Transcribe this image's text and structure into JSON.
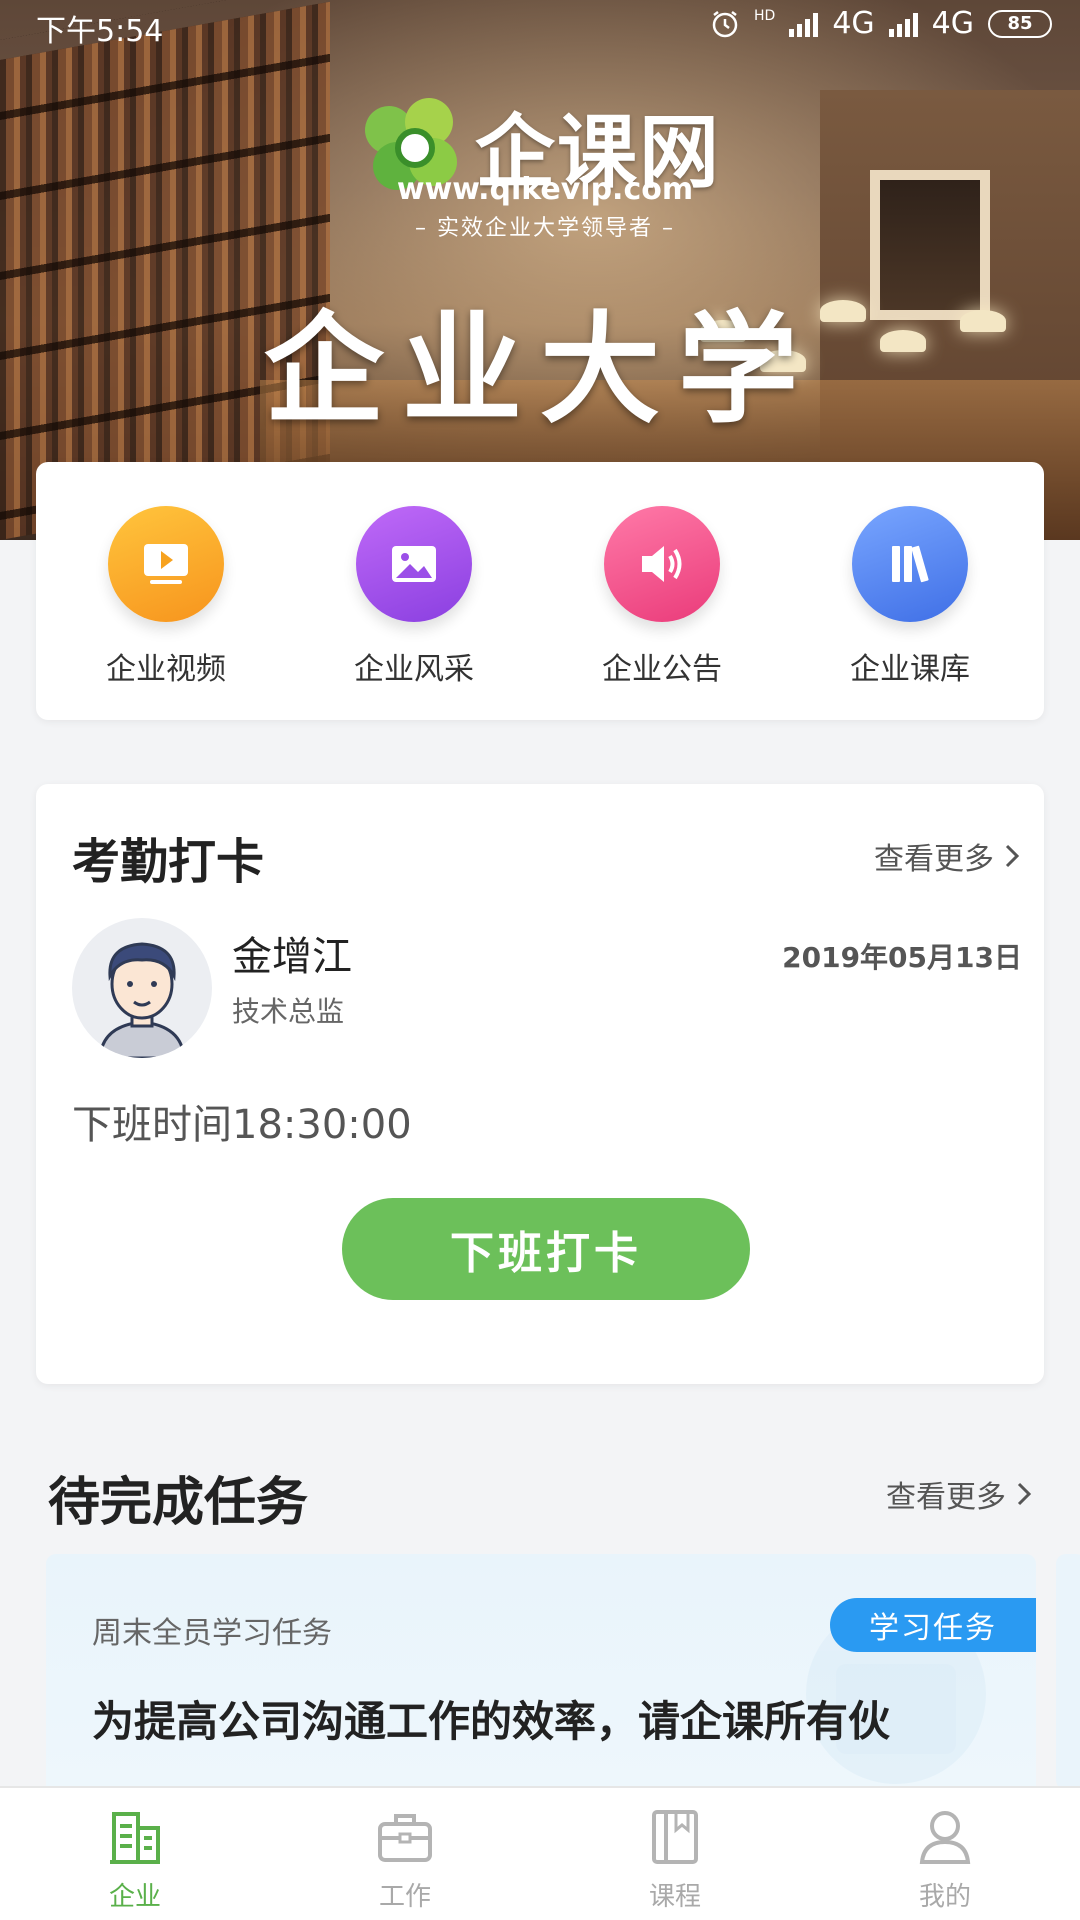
{
  "status_bar": {
    "time": "下午5:54",
    "network_1": "4G",
    "network_2": "4G",
    "hd": "HD",
    "battery": "85"
  },
  "hero": {
    "logo_name": "企课网",
    "url": "www.qikevip.com",
    "slogan": "– 实效企业大学领导者 –",
    "title": "企业大学"
  },
  "quick_actions": [
    {
      "label": "企业视频",
      "icon": "video-play-icon",
      "color": "#f8a823"
    },
    {
      "label": "企业风采",
      "icon": "image-icon",
      "color": "#9b4fe8"
    },
    {
      "label": "企业公告",
      "icon": "speaker-icon",
      "color": "#f24f8d"
    },
    {
      "label": "企业课库",
      "icon": "books-icon",
      "color": "#4f80ef"
    }
  ],
  "attendance": {
    "title": "考勤打卡",
    "more": "查看更多",
    "user_name": "金增江",
    "user_role": "技术总监",
    "date": "2019年05月13日",
    "offwork_time": "下班时间18:30:00",
    "button": "下班打卡"
  },
  "tasks": {
    "title": "待完成任务",
    "more": "查看更多",
    "items": [
      {
        "subtitle": "周末全员学习任务",
        "tag": "学习任务",
        "text": "为提高公司沟通工作的效率，请企课所有伙"
      }
    ]
  },
  "tab_bar": {
    "items": [
      {
        "label": "企业",
        "icon": "enterprise-icon",
        "active": true
      },
      {
        "label": "工作",
        "icon": "briefcase-icon",
        "active": false
      },
      {
        "label": "课程",
        "icon": "book-icon",
        "active": false
      },
      {
        "label": "我的",
        "icon": "user-icon",
        "active": false
      }
    ]
  },
  "colors": {
    "accent_green": "#6cc05a",
    "tab_active": "#5ab04a",
    "tag_blue": "#2a9af2"
  }
}
